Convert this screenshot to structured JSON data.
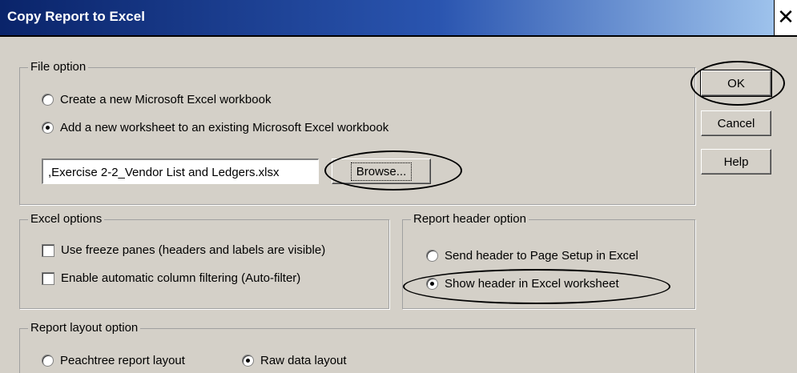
{
  "window": {
    "title": "Copy Report to Excel",
    "close_glyph": "✕"
  },
  "file_option": {
    "label": "File option",
    "radio_new": "Create a new Microsoft Excel workbook",
    "radio_existing": "Add a new worksheet to an existing Microsoft Excel workbook",
    "selected": "existing",
    "path_value": ",Exercise 2-2_Vendor List and Ledgers.xlsx",
    "browse_label": "Browse..."
  },
  "excel_options": {
    "label": "Excel options",
    "freeze_panes": "Use freeze panes (headers and labels are visible)",
    "auto_filter": "Enable automatic column filtering (Auto-filter)",
    "freeze_panes_checked": false,
    "auto_filter_checked": false
  },
  "report_header": {
    "label": "Report header option",
    "send_to_setup": "Send header to Page Setup in Excel",
    "show_in_sheet": "Show header in Excel worksheet",
    "selected": "show_in_sheet"
  },
  "report_layout": {
    "label": "Report layout option",
    "peachtree": "Peachtree report layout",
    "raw": "Raw data layout",
    "selected": "raw"
  },
  "buttons": {
    "ok": "OK",
    "cancel": "Cancel",
    "help": "Help"
  },
  "colors": {
    "dialog_bg": "#d4d0c8",
    "title_start": "#0a246a",
    "title_end": "#a6caf0"
  }
}
